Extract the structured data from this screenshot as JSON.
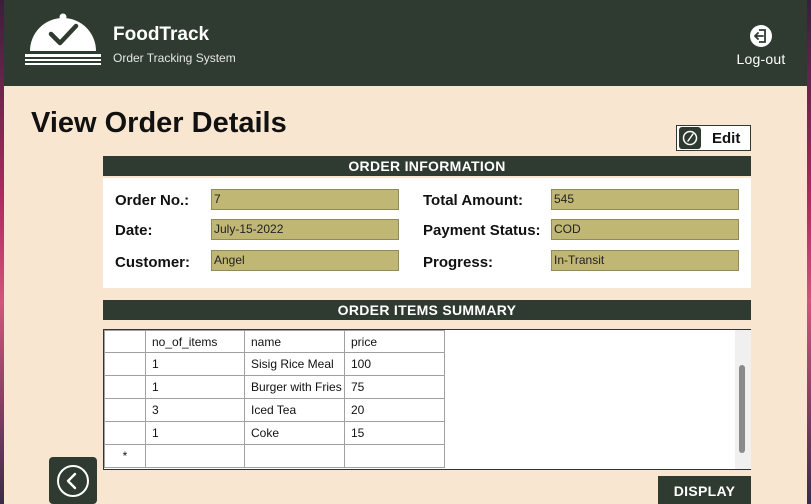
{
  "app": {
    "name": "FoodTrack",
    "subtitle": "Order Tracking System",
    "logout_label": "Log-out"
  },
  "page": {
    "title": "View Order Details",
    "edit_label": "Edit"
  },
  "order_info": {
    "section_title": "ORDER INFORMATION",
    "order_no_label": "Order No.:",
    "order_no": "7",
    "date_label": "Date:",
    "date": "July-15-2022",
    "customer_label": "Customer:",
    "customer": "Angel",
    "total_label": "Total Amount:",
    "total": "545",
    "payment_label": "Payment Status:",
    "payment": "COD",
    "progress_label": "Progress:",
    "progress": "In-Transit"
  },
  "items_summary": {
    "section_title": "ORDER ITEMS SUMMARY",
    "columns": [
      "no_of_items",
      "name",
      "price"
    ],
    "rows": [
      [
        "1",
        "Sisig Rice Meal",
        "100"
      ],
      [
        "1",
        "Burger with Fries",
        "75"
      ],
      [
        "3",
        "Iced Tea",
        "20"
      ],
      [
        "1",
        "Coke",
        "15"
      ]
    ],
    "new_row_marker": "*"
  },
  "buttons": {
    "display_label": "DISPLAY"
  },
  "icons": {
    "logo": "cloche-check-icon",
    "logout": "logout-icon",
    "edit": "edit-gauge-icon",
    "back": "back-arrow-icon"
  },
  "colors": {
    "header": "#2f3b30",
    "background": "#f8e6d1",
    "field": "#c0b774"
  }
}
